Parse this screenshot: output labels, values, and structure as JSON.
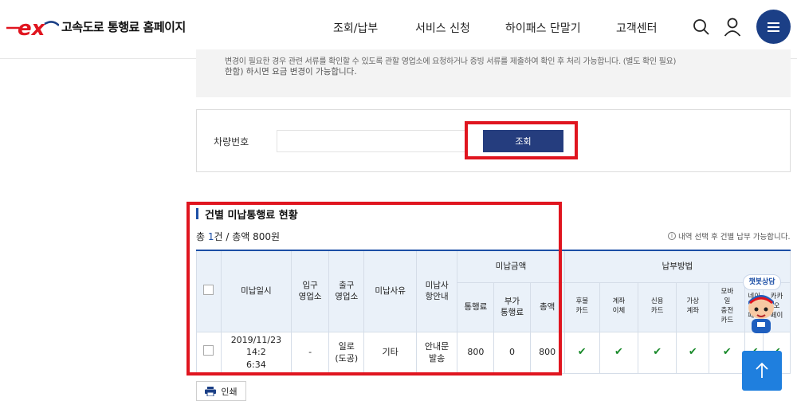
{
  "header": {
    "site_title": "고속도로 통행료 홈페이지",
    "nav": [
      "조회/납부",
      "서비스 신청",
      "하이패스 단말기",
      "고객센터"
    ]
  },
  "notice": {
    "top_line": "변경이 필요한 경우 관련 서류를 확인할 수 있도록 관할 영업소에 요청하거나 증빙 서류를 제출하여 확인 후 처리 가능합니다. (별도 확인 필요)",
    "text": "한함) 하시면 요금 변경이 가능합니다."
  },
  "search": {
    "label": "차량번호",
    "input_value": "",
    "button_label": "조회"
  },
  "section": {
    "title": "건별 미납통행료 현황",
    "summary_prefix": "총 ",
    "summary_count": "1",
    "summary_suffix": "건 / 총액 800원",
    "hint": "내역 선택 후 건별 납부 가능합니다."
  },
  "table": {
    "headers": {
      "date": "미납일시",
      "entry": "입구\n영업소",
      "exit": "출구\n영업소",
      "reason": "미납사유",
      "guide": "미납사\n항안내",
      "amount_group": "미납금액",
      "toll": "통행료",
      "surcharge": "부가\n통행료",
      "total": "총액",
      "method_group": "납부방법",
      "methods": [
        "후불\n카드",
        "계좌\n이체",
        "신용\n카드",
        "가상\n계좌",
        "모바\n일\n충전\n카드",
        "네이\n버\n페이",
        "카카\n오\n페이"
      ]
    },
    "rows": [
      {
        "date": "2019/11/23 14:2\n6:34",
        "entry": "-",
        "exit": "일로\n(도공)",
        "reason": "기타",
        "guide": "안내문\n발송",
        "toll": "800",
        "surcharge": "0",
        "total": "800",
        "methods": [
          "✔",
          "✔",
          "✔",
          "✔",
          "✔",
          "✔",
          "✔"
        ]
      }
    ]
  },
  "print_label": "인쇄",
  "chatbot_label": "챗봇상담",
  "colors": {
    "brand_blue": "#1b3f86",
    "button_blue": "#253d7e",
    "highlight_red": "#e0151f",
    "check_green": "#1a8a2b",
    "top_button": "#1f7fde"
  }
}
